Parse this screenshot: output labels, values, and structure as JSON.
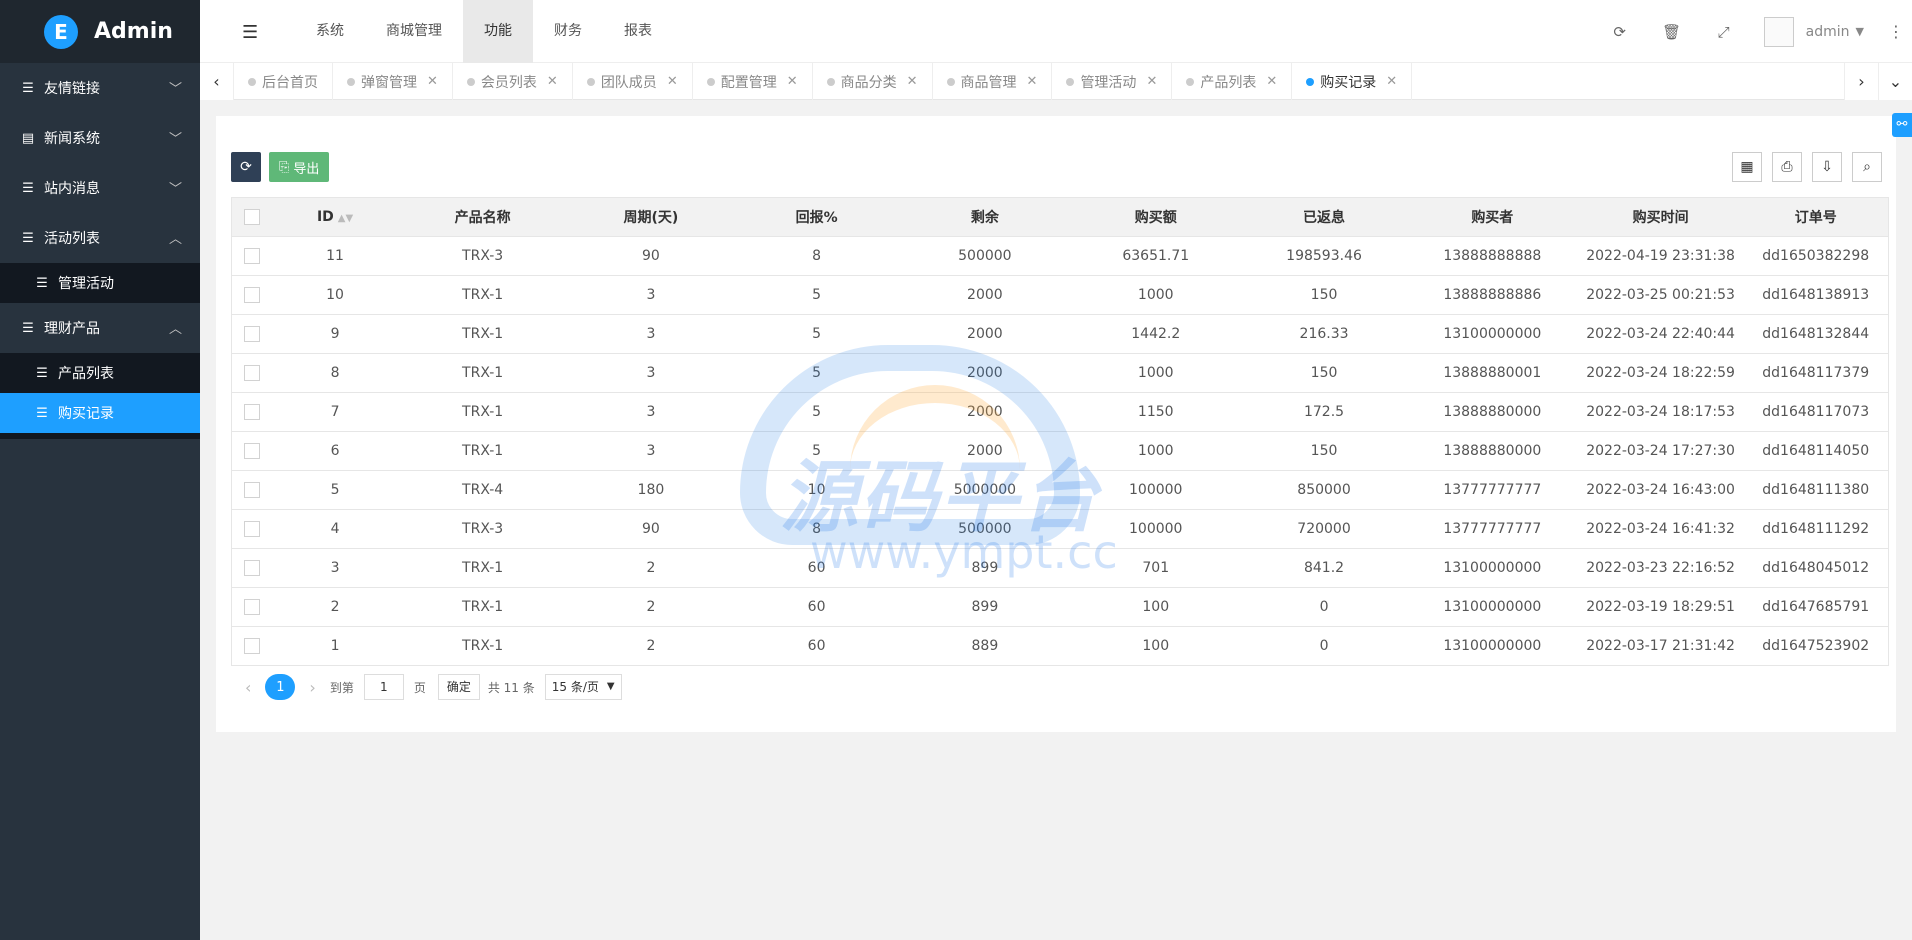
{
  "app": {
    "title": "Admin",
    "logo_letter": "E"
  },
  "sidebar": {
    "items": [
      {
        "label": "友情链接",
        "icon": "list-icon",
        "arrow": "﹀"
      },
      {
        "label": "新闻系统",
        "icon": "newspaper-icon",
        "arrow": "﹀"
      },
      {
        "label": "站内消息",
        "icon": "list-icon",
        "arrow": "﹀"
      },
      {
        "label": "活动列表",
        "icon": "list-icon",
        "arrow": "︿",
        "children": [
          {
            "label": "管理活动"
          }
        ]
      },
      {
        "label": "理财产品",
        "icon": "list-icon",
        "arrow": "︿",
        "children": [
          {
            "label": "产品列表"
          },
          {
            "label": "购买记录",
            "active": true
          }
        ]
      }
    ]
  },
  "header": {
    "nav": [
      "系统",
      "商城管理",
      "功能",
      "财务",
      "报表"
    ],
    "active_nav": "功能",
    "username": "admin",
    "icons": [
      "refresh-icon",
      "trash-icon",
      "fullscreen-icon"
    ]
  },
  "tabs": {
    "items": [
      "后台首页",
      "弹窗管理",
      "会员列表",
      "团队成员",
      "配置管理",
      "商品分类",
      "商品管理",
      "管理活动",
      "产品列表",
      "购买记录"
    ],
    "active": "购买记录"
  },
  "toolbar": {
    "export_label": "导出"
  },
  "table": {
    "columns": [
      "ID",
      "产品名称",
      "周期(天)",
      "回报%",
      "剩余",
      "购买额",
      "已返息",
      "购买者",
      "购买时间",
      "订单号"
    ],
    "rows": [
      [
        "11",
        "TRX-3",
        "90",
        "8",
        "500000",
        "63651.71",
        "198593.46",
        "13888888888",
        "2022-04-19 23:31:38",
        "dd1650382298"
      ],
      [
        "10",
        "TRX-1",
        "3",
        "5",
        "2000",
        "1000",
        "150",
        "13888888886",
        "2022-03-25 00:21:53",
        "dd1648138913"
      ],
      [
        "9",
        "TRX-1",
        "3",
        "5",
        "2000",
        "1442.2",
        "216.33",
        "13100000000",
        "2022-03-24 22:40:44",
        "dd1648132844"
      ],
      [
        "8",
        "TRX-1",
        "3",
        "5",
        "2000",
        "1000",
        "150",
        "13888880001",
        "2022-03-24 18:22:59",
        "dd1648117379"
      ],
      [
        "7",
        "TRX-1",
        "3",
        "5",
        "2000",
        "1150",
        "172.5",
        "13888880000",
        "2022-03-24 18:17:53",
        "dd1648117073"
      ],
      [
        "6",
        "TRX-1",
        "3",
        "5",
        "2000",
        "1000",
        "150",
        "13888880000",
        "2022-03-24 17:27:30",
        "dd1648114050"
      ],
      [
        "5",
        "TRX-4",
        "180",
        "10",
        "5000000",
        "100000",
        "850000",
        "13777777777",
        "2022-03-24 16:43:00",
        "dd1648111380"
      ],
      [
        "4",
        "TRX-3",
        "90",
        "8",
        "500000",
        "100000",
        "720000",
        "13777777777",
        "2022-03-24 16:41:32",
        "dd1648111292"
      ],
      [
        "3",
        "TRX-1",
        "2",
        "60",
        "899",
        "701",
        "841.2",
        "13100000000",
        "2022-03-23 22:16:52",
        "dd1648045012"
      ],
      [
        "2",
        "TRX-1",
        "2",
        "60",
        "899",
        "100",
        "0",
        "13100000000",
        "2022-03-19 18:29:51",
        "dd1647685791"
      ],
      [
        "1",
        "TRX-1",
        "2",
        "60",
        "889",
        "100",
        "0",
        "13100000000",
        "2022-03-17 21:31:42",
        "dd1647523902"
      ]
    ]
  },
  "pager": {
    "current": "1",
    "goto_label": "到第",
    "goto_value": "1",
    "page_label": "页",
    "confirm_label": "确定",
    "total_label": "共 11 条",
    "page_size": "15 条/页"
  },
  "watermark": {
    "text": "源码平台",
    "url": "www.ympt.cc"
  },
  "colors": {
    "accent": "#1e9fff",
    "sidebar": "#28333e",
    "export": "#5fb878",
    "refresh": "#2f4056"
  }
}
